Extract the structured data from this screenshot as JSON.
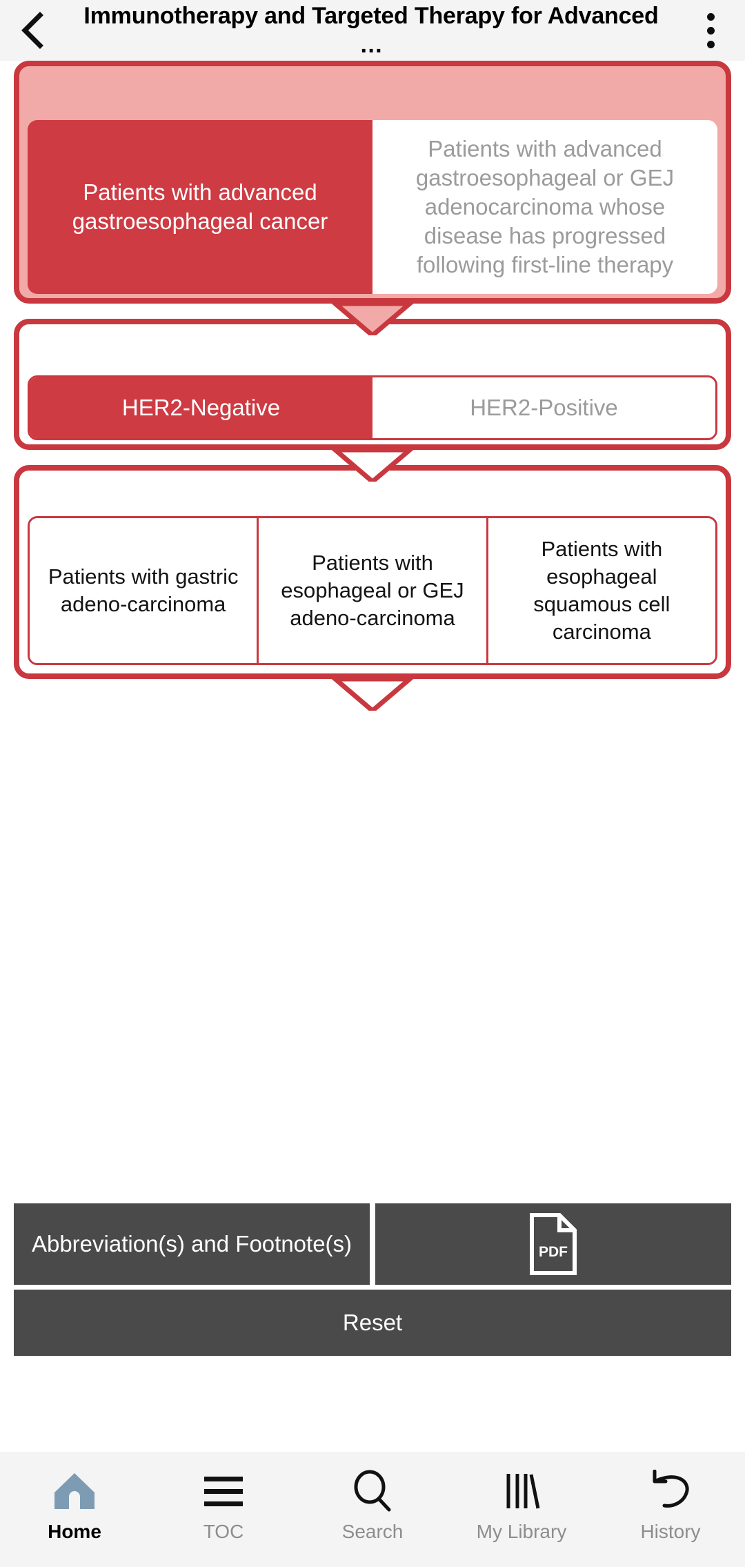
{
  "header": {
    "back_icon": "chevron-left-icon",
    "title": "Immunotherapy and Targeted Therapy for Advanced …",
    "menu_icon": "overflow-menu-icon"
  },
  "flow": {
    "steps": [
      {
        "id": "step-population",
        "style": "shaded",
        "options": [
          {
            "label": "Patients with advanced gastroesophageal cancer",
            "state": "selected"
          },
          {
            "label": "Patients with advanced gastroesophageal or GEJ adenocarcinoma whose disease has progressed following first-line therapy",
            "state": "unselected"
          }
        ]
      },
      {
        "id": "step-her2",
        "style": "plain",
        "options": [
          {
            "label": "HER2-Negative",
            "state": "selected"
          },
          {
            "label": "HER2-Positive",
            "state": "unselected"
          }
        ]
      },
      {
        "id": "step-histology",
        "style": "plain",
        "options": [
          {
            "label": "Patients with gastric adeno-carcinoma",
            "state": "neutral"
          },
          {
            "label": "Patients with esophageal or GEJ adeno-carcinoma",
            "state": "neutral"
          },
          {
            "label": "Patients with esophageal squamous cell carcinoma",
            "state": "neutral"
          }
        ]
      }
    ]
  },
  "actions": {
    "abbreviations_label": "Abbreviation(s) and Footnote(s)",
    "pdf_icon": "pdf-document-icon",
    "pdf_icon_text": "PDF",
    "reset_label": "Reset"
  },
  "bottom_nav": {
    "items": [
      {
        "label": "Home",
        "icon": "home-icon",
        "active": true
      },
      {
        "label": "TOC",
        "icon": "list-lines-icon",
        "active": false
      },
      {
        "label": "Search",
        "icon": "magnifier-icon",
        "active": false
      },
      {
        "label": "My Library",
        "icon": "books-icon",
        "active": false
      },
      {
        "label": "History",
        "icon": "undo-arrow-icon",
        "active": false
      }
    ]
  },
  "colors": {
    "accent_red": "#ce3b43",
    "border_red": "#c9383f",
    "shade_pink": "#f2aaa8",
    "dark_button": "#4a4a4a",
    "home_blue": "#7d9cb3",
    "muted_text": "#9b9b9b"
  }
}
